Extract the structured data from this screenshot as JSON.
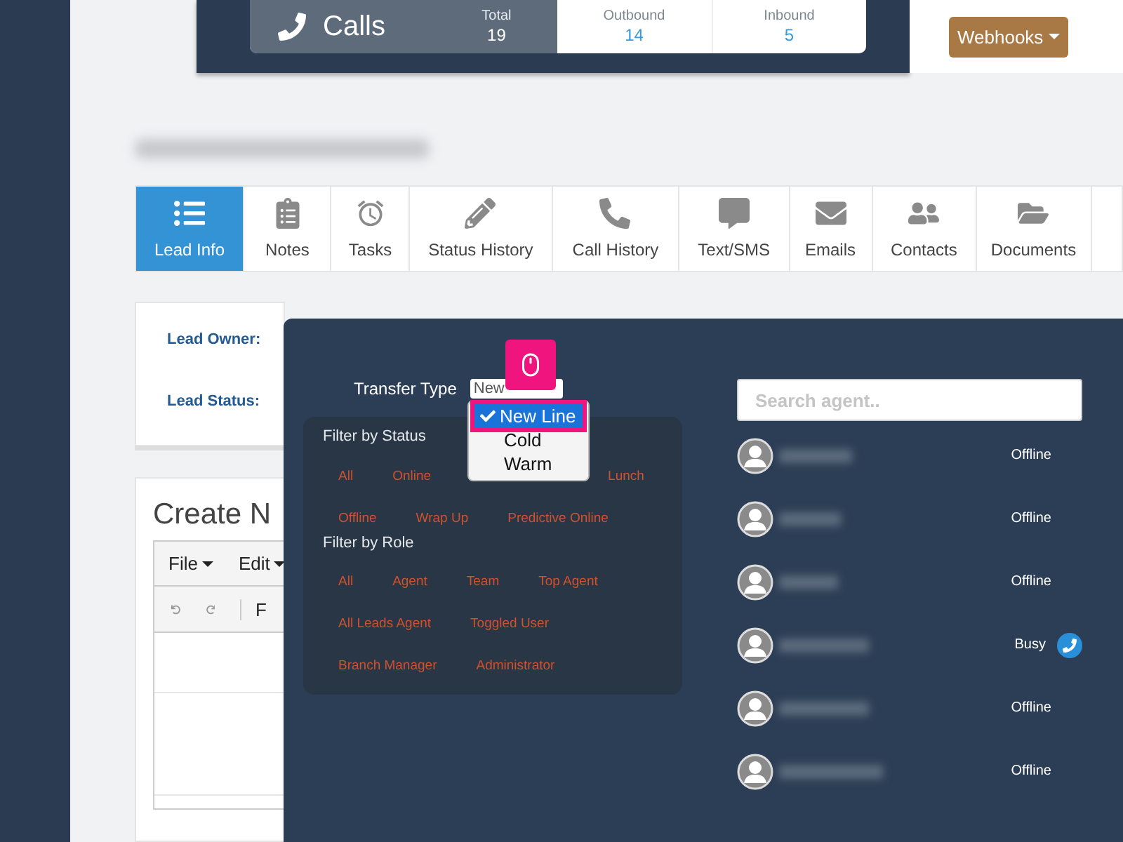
{
  "header": {
    "calls_label": "Calls",
    "stats": [
      {
        "label": "Total",
        "value": "19",
        "kind": "main"
      },
      {
        "label": "Outbound",
        "value": "14",
        "kind": "link"
      },
      {
        "label": "Inbound",
        "value": "5",
        "kind": "link"
      }
    ],
    "webhooks_button": "Webhooks"
  },
  "tabs": [
    {
      "label": "Lead Info",
      "selected": true
    },
    {
      "label": "Notes",
      "selected": false
    },
    {
      "label": "Tasks",
      "selected": false
    },
    {
      "label": "Status History",
      "selected": false
    },
    {
      "label": "Call History",
      "selected": false
    },
    {
      "label": "Text/SMS",
      "selected": false
    },
    {
      "label": "Emails",
      "selected": false
    },
    {
      "label": "Contacts",
      "selected": false
    },
    {
      "label": "Documents",
      "selected": false
    }
  ],
  "lead_fields": [
    {
      "label": "Lead Owner:"
    },
    {
      "label": "Lead Status:"
    }
  ],
  "create_note": {
    "title": "Create N",
    "menus": [
      "File",
      "Edit"
    ],
    "toolbar_text": "F"
  },
  "transfer": {
    "label": "Transfer Type",
    "value": "New",
    "options": [
      {
        "label": "New Line",
        "selected": true
      },
      {
        "label": "Cold",
        "selected": false
      },
      {
        "label": "Warm",
        "selected": false
      }
    ],
    "filter_status": {
      "title": "Filter by Status",
      "chips": [
        "All",
        "Online",
        "Lunch",
        "Offline",
        "Wrap Up",
        "Predictive Online"
      ]
    },
    "filter_role": {
      "title": "Filter by Role",
      "chips": [
        "All",
        "Agent",
        "Team",
        "Top Agent",
        "All Leads Agent",
        "Toggled User",
        "Branch Manager",
        "Administrator"
      ]
    },
    "search": {
      "placeholder": "Search agent.."
    },
    "agents": [
      {
        "status": "Offline",
        "kind": "offline"
      },
      {
        "status": "Offline",
        "kind": "offline"
      },
      {
        "status": "Offline",
        "kind": "offline"
      },
      {
        "status": "Busy",
        "kind": "busy"
      },
      {
        "status": "Offline",
        "kind": "offline"
      },
      {
        "status": "Offline",
        "kind": "offline"
      }
    ]
  }
}
